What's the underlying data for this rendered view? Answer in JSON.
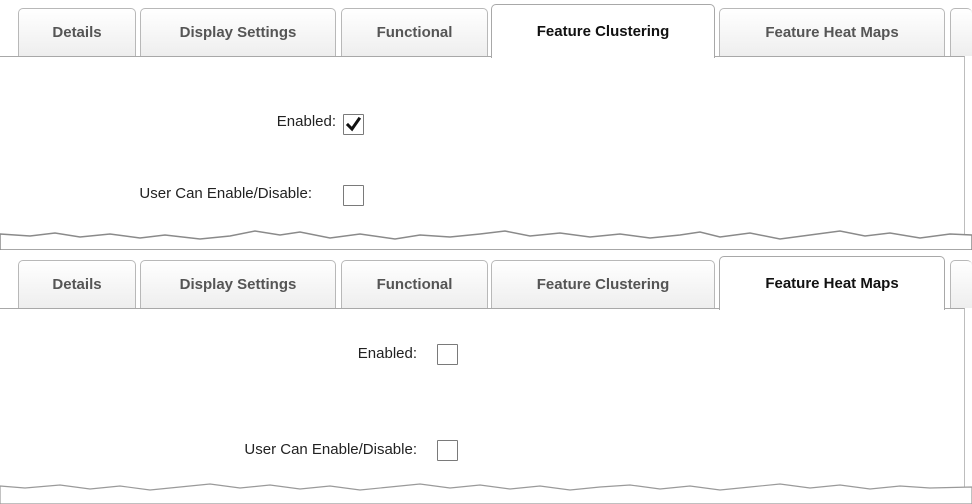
{
  "panels": [
    {
      "tabs": [
        "Details",
        "Display Settings",
        "Functional",
        "Feature Clustering",
        "Feature Heat Maps"
      ],
      "active_tab": "Feature Clustering",
      "fields": {
        "enabled": {
          "label": "Enabled:",
          "checked": true
        },
        "user_can_toggle": {
          "label": "User Can Enable/Disable:",
          "checked": false
        }
      }
    },
    {
      "tabs": [
        "Details",
        "Display Settings",
        "Functional",
        "Feature Clustering",
        "Feature Heat Maps"
      ],
      "active_tab": "Feature Heat Maps",
      "fields": {
        "enabled": {
          "label": "Enabled:",
          "checked": false
        },
        "user_can_toggle": {
          "label": "User Can Enable/Disable:",
          "checked": false
        }
      }
    }
  ],
  "colors": {
    "tab_border": "#b8b8b8",
    "checkbox_border": "#7a7a7a",
    "checkmark": "#111111"
  }
}
